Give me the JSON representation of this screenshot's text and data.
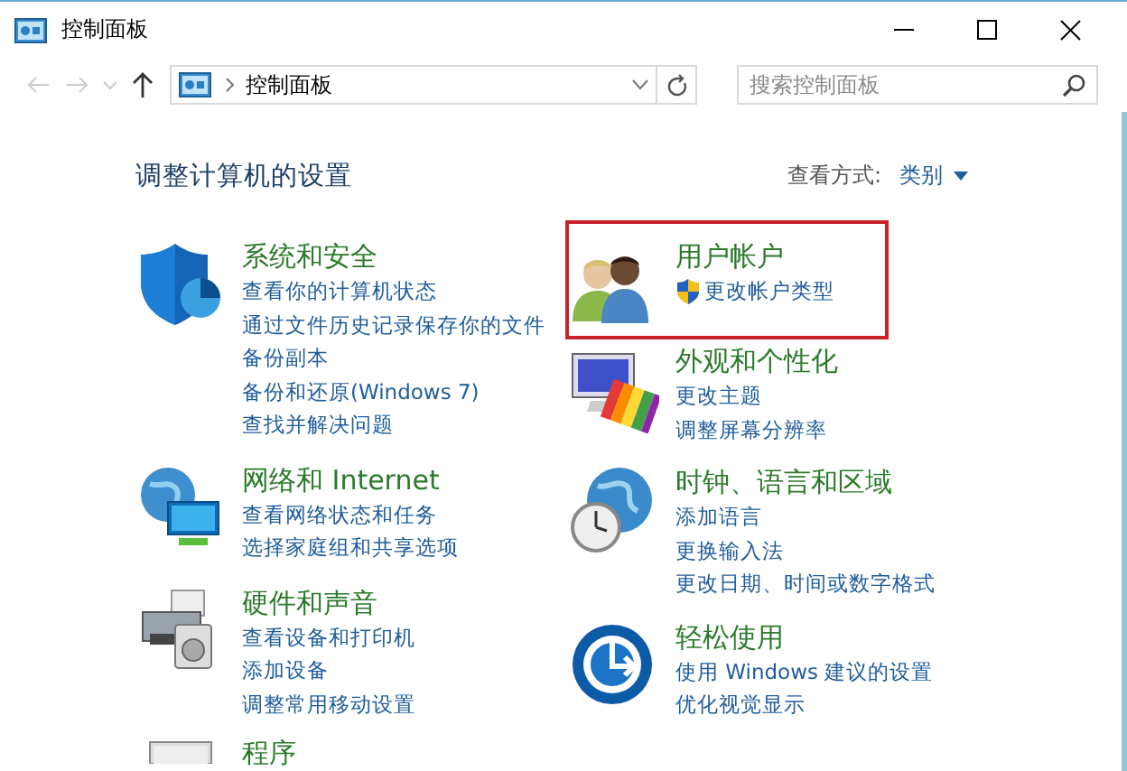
{
  "window": {
    "title": "控制面板"
  },
  "navigation": {
    "address": "控制面板",
    "search_placeholder": "搜索控制面板"
  },
  "heading": "调整计算机的设置",
  "view_by": {
    "label": "查看方式:",
    "value": "类别"
  },
  "columns": [
    {
      "categories": [
        {
          "kind": "security",
          "title": "系统和安全",
          "highlighted": false,
          "links": [
            {
              "text": "查看你的计算机状态",
              "shield": false
            },
            {
              "text": "通过文件历史记录保存你的文件",
              "shield": false
            },
            {
              "text": "备份副本",
              "shield": false
            },
            {
              "text": "备份和还原(Windows 7)",
              "shield": false
            },
            {
              "text": "查找并解决问题",
              "shield": false
            }
          ]
        },
        {
          "kind": "network",
          "title": "网络和 Internet",
          "highlighted": false,
          "links": [
            {
              "text": "查看网络状态和任务",
              "shield": false
            },
            {
              "text": "选择家庭组和共享选项",
              "shield": false
            }
          ]
        },
        {
          "kind": "hardware",
          "title": "硬件和声音",
          "highlighted": false,
          "links": [
            {
              "text": "查看设备和打印机",
              "shield": false
            },
            {
              "text": "添加设备",
              "shield": false
            },
            {
              "text": "调整常用移动设置",
              "shield": false
            }
          ]
        },
        {
          "kind": "programs",
          "title": "程序",
          "highlighted": false
        }
      ]
    },
    {
      "categories": [
        {
          "kind": "users",
          "title": "用户帐户",
          "highlighted": true,
          "links": [
            {
              "text": "更改帐户类型",
              "shield": true
            }
          ]
        },
        {
          "kind": "appearance",
          "title": "外观和个性化",
          "highlighted": false,
          "links": [
            {
              "text": "更改主题",
              "shield": false
            },
            {
              "text": "调整屏幕分辨率",
              "shield": false
            }
          ]
        },
        {
          "kind": "clock",
          "title": "时钟、语言和区域",
          "highlighted": false,
          "links": [
            {
              "text": "添加语言",
              "shield": false
            },
            {
              "text": "更换输入法",
              "shield": false
            },
            {
              "text": "更改日期、时间或数字格式",
              "shield": false
            }
          ]
        },
        {
          "kind": "ease",
          "title": "轻松使用",
          "highlighted": false,
          "links": [
            {
              "text": "使用 Windows 建议的设置",
              "shield": false
            },
            {
              "text": "优化视觉显示",
              "shield": false
            }
          ]
        }
      ]
    }
  ]
}
